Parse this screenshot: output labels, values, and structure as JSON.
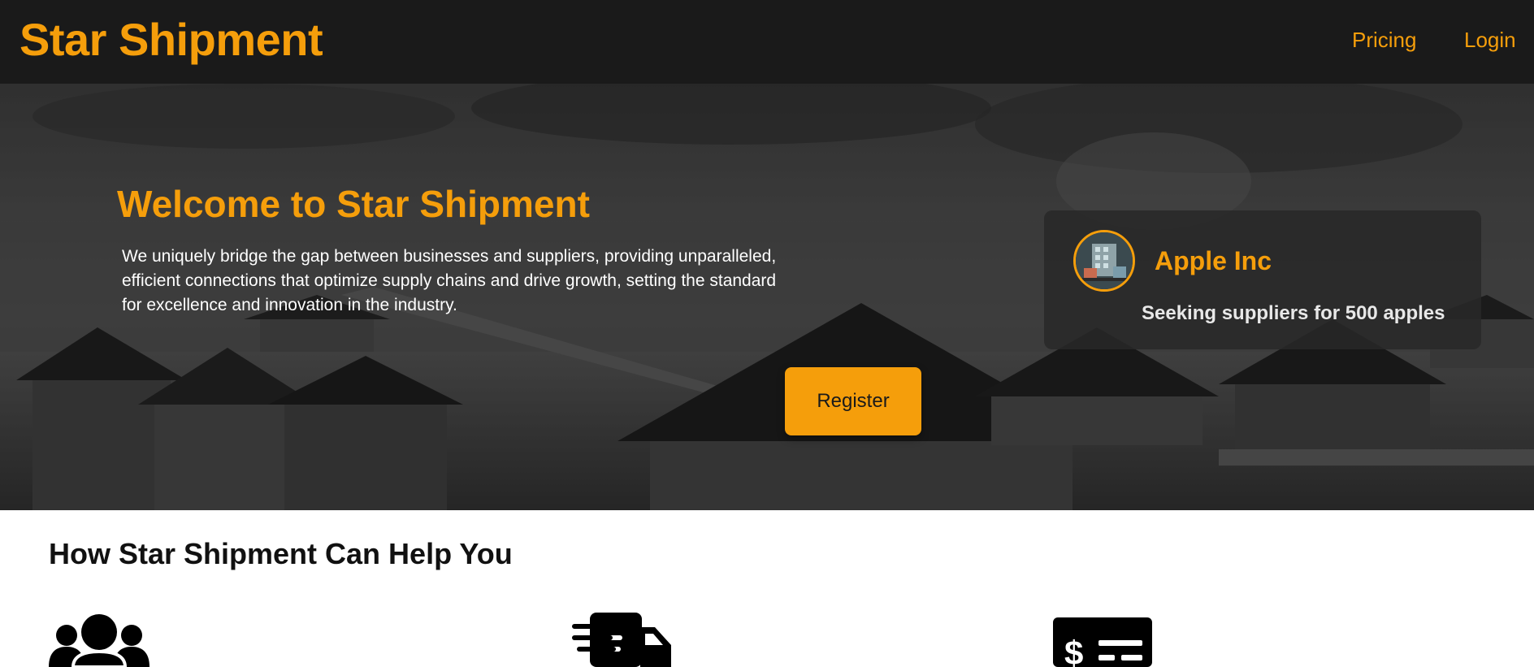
{
  "navbar": {
    "brand": "Star Shipment",
    "links": [
      {
        "label": "Pricing"
      },
      {
        "label": "Login"
      }
    ]
  },
  "hero": {
    "title": "Welcome to Star Shipment",
    "description": "We uniquely bridge the gap between businesses and suppliers, providing unparalleled, efficient connections that optimize supply chains and drive growth, setting the standard for excellence and innovation in the industry.",
    "register_label": "Register"
  },
  "card": {
    "name": "Apple Inc",
    "text": "Seeking suppliers for 500 apples",
    "avatar_icon": "building-avatar-icon"
  },
  "section": {
    "title": "How Star Shipment Can Help You",
    "icons": [
      "users-icon",
      "truck-icon",
      "money-check-icon"
    ]
  },
  "colors": {
    "accent": "#f59e0b",
    "navbar_bg": "#1a1a1a"
  }
}
